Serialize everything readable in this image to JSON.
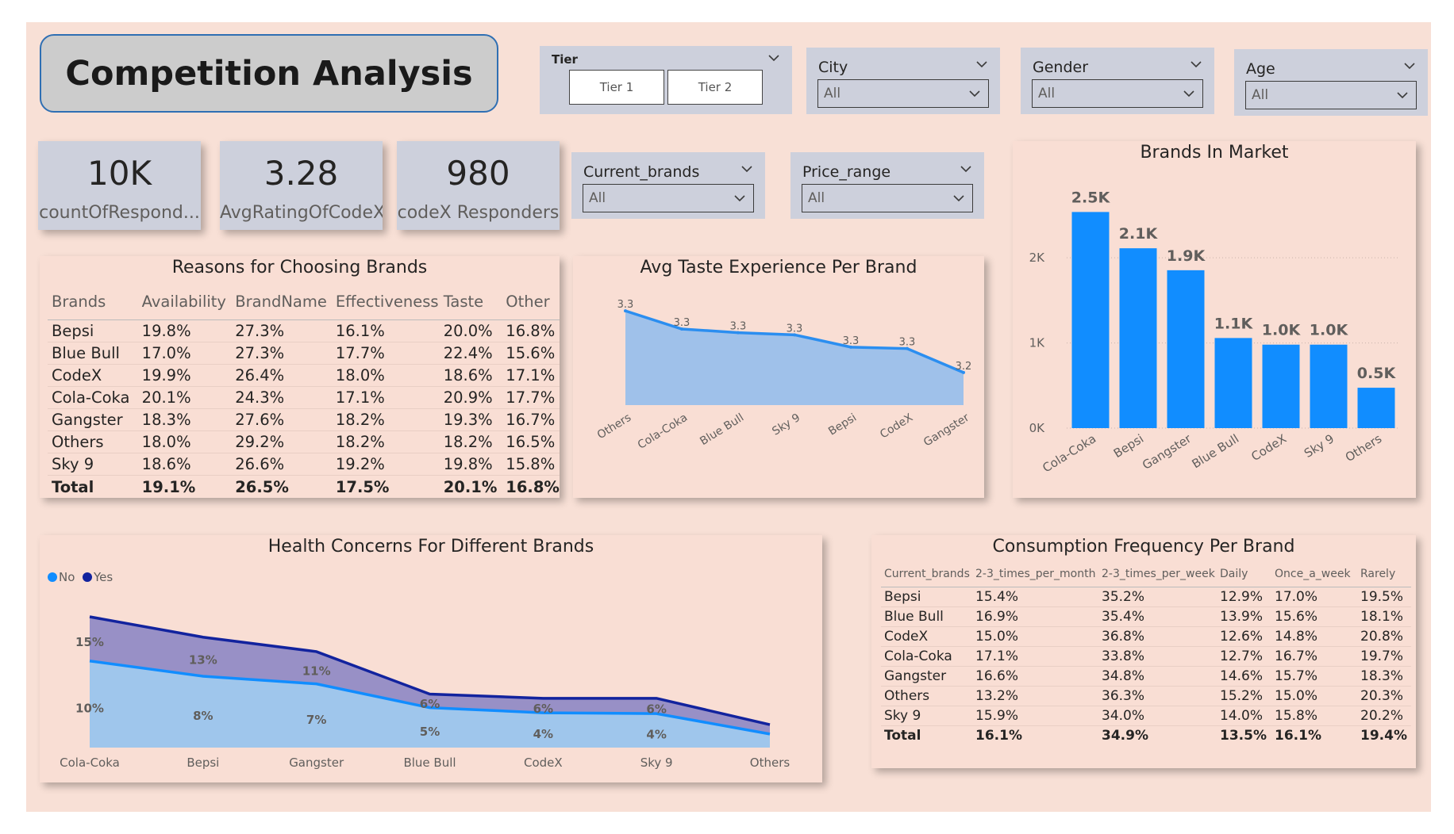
{
  "header": {
    "title": "Competition Analysis"
  },
  "filters": {
    "tier": {
      "label": "Tier",
      "options": [
        "Tier 1",
        "Tier 2"
      ]
    },
    "city": {
      "label": "City",
      "value": "All"
    },
    "gender": {
      "label": "Gender",
      "value": "All"
    },
    "age": {
      "label": "Age",
      "value": "All"
    },
    "current_brands": {
      "label": "Current_brands",
      "value": "All"
    },
    "price_range": {
      "label": "Price_range",
      "value": "All"
    }
  },
  "kpis": [
    {
      "value": "10K",
      "caption": "countOfRespond..."
    },
    {
      "value": "3.28",
      "caption": "AvgRatingOfCodeX"
    },
    {
      "value": "980",
      "caption": "codeX Responders"
    }
  ],
  "reasons_table": {
    "title": "Reasons for Choosing Brands",
    "columns": [
      "Brands",
      "Availability",
      "BrandName",
      "Effectiveness",
      "Taste",
      "Other"
    ],
    "rows": [
      [
        "Bepsi",
        "19.8%",
        "27.3%",
        "16.1%",
        "20.0%",
        "16.8%"
      ],
      [
        "Blue Bull",
        "17.0%",
        "27.3%",
        "17.7%",
        "22.4%",
        "15.6%"
      ],
      [
        "CodeX",
        "19.9%",
        "26.4%",
        "18.0%",
        "18.6%",
        "17.1%"
      ],
      [
        "Cola-Coka",
        "20.1%",
        "24.3%",
        "17.1%",
        "20.9%",
        "17.7%"
      ],
      [
        "Gangster",
        "18.3%",
        "27.6%",
        "18.2%",
        "19.3%",
        "16.7%"
      ],
      [
        "Others",
        "18.0%",
        "29.2%",
        "18.2%",
        "18.2%",
        "16.5%"
      ],
      [
        "Sky 9",
        "18.6%",
        "26.6%",
        "19.2%",
        "19.8%",
        "15.8%"
      ]
    ],
    "total": [
      "Total",
      "19.1%",
      "26.5%",
      "17.5%",
      "20.1%",
      "16.8%"
    ]
  },
  "frequency_table": {
    "title": "Consumption Frequency Per Brand",
    "columns": [
      "Current_brands",
      "2-3_times_per_month",
      "2-3_times_per_week",
      "Daily",
      "Once_a_week",
      "Rarely"
    ],
    "rows": [
      [
        "Bepsi",
        "15.4%",
        "35.2%",
        "12.9%",
        "17.0%",
        "19.5%"
      ],
      [
        "Blue Bull",
        "16.9%",
        "35.4%",
        "13.9%",
        "15.6%",
        "18.1%"
      ],
      [
        "CodeX",
        "15.0%",
        "36.8%",
        "12.6%",
        "14.8%",
        "20.8%"
      ],
      [
        "Cola-Coka",
        "17.1%",
        "33.8%",
        "12.7%",
        "16.7%",
        "19.7%"
      ],
      [
        "Gangster",
        "16.6%",
        "34.8%",
        "14.6%",
        "15.7%",
        "18.3%"
      ],
      [
        "Others",
        "13.2%",
        "36.3%",
        "15.2%",
        "15.0%",
        "20.3%"
      ],
      [
        "Sky 9",
        "15.9%",
        "34.0%",
        "14.0%",
        "15.8%",
        "20.2%"
      ]
    ],
    "total": [
      "Total",
      "16.1%",
      "34.9%",
      "13.5%",
      "16.1%",
      "19.4%"
    ]
  },
  "chart_data": [
    {
      "id": "taste",
      "type": "area",
      "title": "Avg Taste Experience Per Brand",
      "categories": [
        "Others",
        "Cola-Coka",
        "Blue Bull",
        "Sky 9",
        "Bepsi",
        "CodeX",
        "Gangster"
      ],
      "values": [
        3.32,
        3.295,
        3.29,
        3.287,
        3.27,
        3.268,
        3.235
      ],
      "data_labels": [
        "3.3",
        "3.3",
        "3.3",
        "3.3",
        "3.3",
        "3.3",
        "3.2"
      ],
      "ylim": [
        3.19,
        3.33
      ],
      "colors": {
        "line": "#2b8ef0",
        "fill": "#9fc1ea"
      }
    },
    {
      "id": "market",
      "type": "bar",
      "title": "Brands In Market",
      "categories": [
        "Cola-Coka",
        "Bepsi",
        "Gangster",
        "Blue Bull",
        "CodeX",
        "Sky 9",
        "Others"
      ],
      "values": [
        2538,
        2112,
        1854,
        1058,
        980,
        980,
        474
      ],
      "data_labels": [
        "2.5K",
        "2.1K",
        "1.9K",
        "1.1K",
        "1.0K",
        "1.0K",
        "0.5K"
      ],
      "y_ticks": [
        "0K",
        "1K",
        "2K"
      ],
      "ylim": [
        0,
        2700
      ],
      "grid": true,
      "colors": {
        "bar": "#118dff"
      }
    },
    {
      "id": "health",
      "type": "area",
      "title": "Health Concerns For Different Brands",
      "categories": [
        "Cola-Coka",
        "Bepsi",
        "Gangster",
        "Blue Bull",
        "CodeX",
        "Sky 9",
        "Others"
      ],
      "series": [
        {
          "name": "No",
          "values": [
            10.2,
            8.4,
            7.5,
            4.7,
            4.1,
            4.0,
            1.6
          ],
          "labels": [
            "10%",
            "8%",
            "7%",
            "5%",
            "4%",
            "4%",
            ""
          ],
          "color": "#118dff"
        },
        {
          "name": "Yes",
          "values": [
            15.4,
            13.0,
            11.3,
            6.3,
            5.8,
            5.8,
            2.7
          ],
          "labels": [
            "15%",
            "13%",
            "11%",
            "6%",
            "6%",
            "6%",
            ""
          ],
          "color": "#12239e"
        }
      ],
      "legend_position": "top-left",
      "ylim": [
        0,
        16.8
      ]
    }
  ]
}
